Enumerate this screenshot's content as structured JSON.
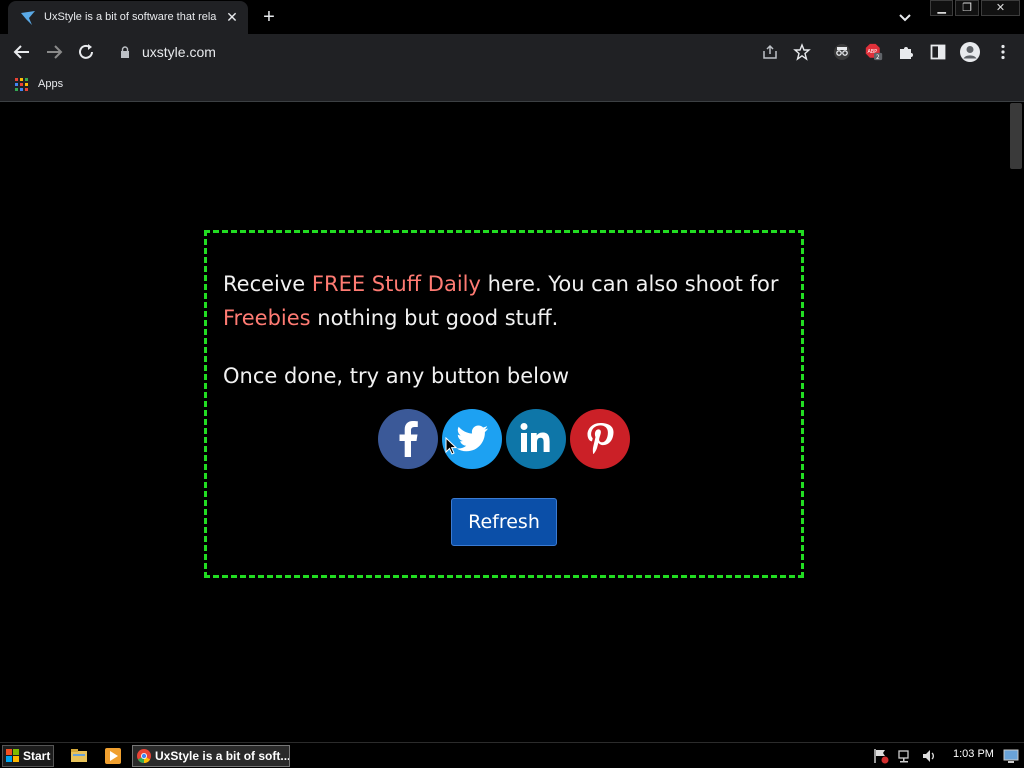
{
  "browser": {
    "tab": {
      "title": "UxStyle is a bit of software that rela",
      "close_glyph": "✕"
    },
    "new_tab_glyph": "+",
    "window_controls": {
      "minimize": "▁",
      "restore": "❐",
      "close": "✕"
    },
    "address": {
      "url": "uxstyle.com"
    },
    "bookmarks": {
      "apps_label": "Apps"
    },
    "extension_badge": "2"
  },
  "page": {
    "para1_prefix": "Receive ",
    "para1_highlight1": "FREE Stuff Daily",
    "para1_middle": " here. You can also shoot for ",
    "para1_highlight2": "Freebies",
    "para1_suffix": " nothing but good stuff.",
    "para2": "Once done, try any button below",
    "social_buttons": [
      "facebook",
      "twitter",
      "linkedin",
      "pinterest"
    ],
    "refresh_label": "Refresh",
    "colors": {
      "highlight": "#ff7b73",
      "border": "#22dd22",
      "button": "#0b4fa8"
    }
  },
  "taskbar": {
    "start_label": "Start",
    "task_label": "UxStyle is a bit of soft...",
    "clock": "1:03 PM"
  }
}
